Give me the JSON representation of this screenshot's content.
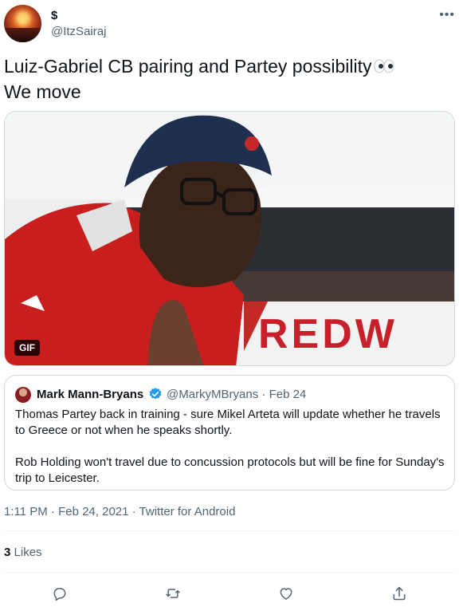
{
  "author": {
    "name": "$",
    "handle": "@ItzSairaj"
  },
  "tweet": {
    "line1": "Luiz-Gabriel CB pairing and Partey possibility",
    "line2": "We move",
    "emoji": "eyes-emoji"
  },
  "media": {
    "badge": "GIF",
    "sign_text": "REDW"
  },
  "quote": {
    "name": "Mark Mann-Bryans",
    "handle_date": "@MarkyMBryans · Feb 24",
    "paragraph1": "Thomas Partey back in training - sure Mikel Arteta will update whether he travels to Greece or not when he speaks shortly.",
    "paragraph2": "Rob Holding won't travel due to concussion protocols but will be fine for Sunday's trip to Leicester."
  },
  "meta": {
    "timestamp": "1:11 PM · Feb 24, 2021 · Twitter for Android"
  },
  "stats": {
    "likes_count": "3",
    "likes_label": "Likes"
  },
  "actions": [
    "reply-icon",
    "retweet-icon",
    "like-icon",
    "share-icon"
  ],
  "colors": {
    "text": "#0f1419",
    "secondary": "#536471",
    "border": "#cfd9de",
    "verified": "#1d9bf0"
  }
}
